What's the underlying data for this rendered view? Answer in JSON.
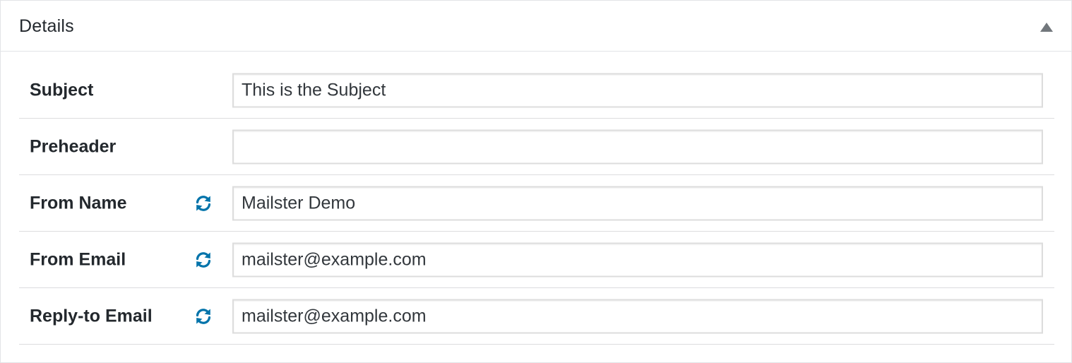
{
  "panel": {
    "title": "Details",
    "toggle_icon": "triangle-up-icon"
  },
  "fields": [
    {
      "label": "Subject",
      "value": "This is the Subject",
      "has_refresh": false
    },
    {
      "label": "Preheader",
      "value": "",
      "has_refresh": false
    },
    {
      "label": "From Name",
      "value": "Mailster Demo",
      "has_refresh": true
    },
    {
      "label": "From Email",
      "value": "mailster@example.com",
      "has_refresh": true
    },
    {
      "label": "Reply-to Email",
      "value": "mailster@example.com",
      "has_refresh": true
    }
  ],
  "colors": {
    "refresh_icon": "#0073aa",
    "border": "#e2e4e7",
    "text": "#23282d"
  },
  "icons": {
    "refresh": "refresh-icon"
  }
}
